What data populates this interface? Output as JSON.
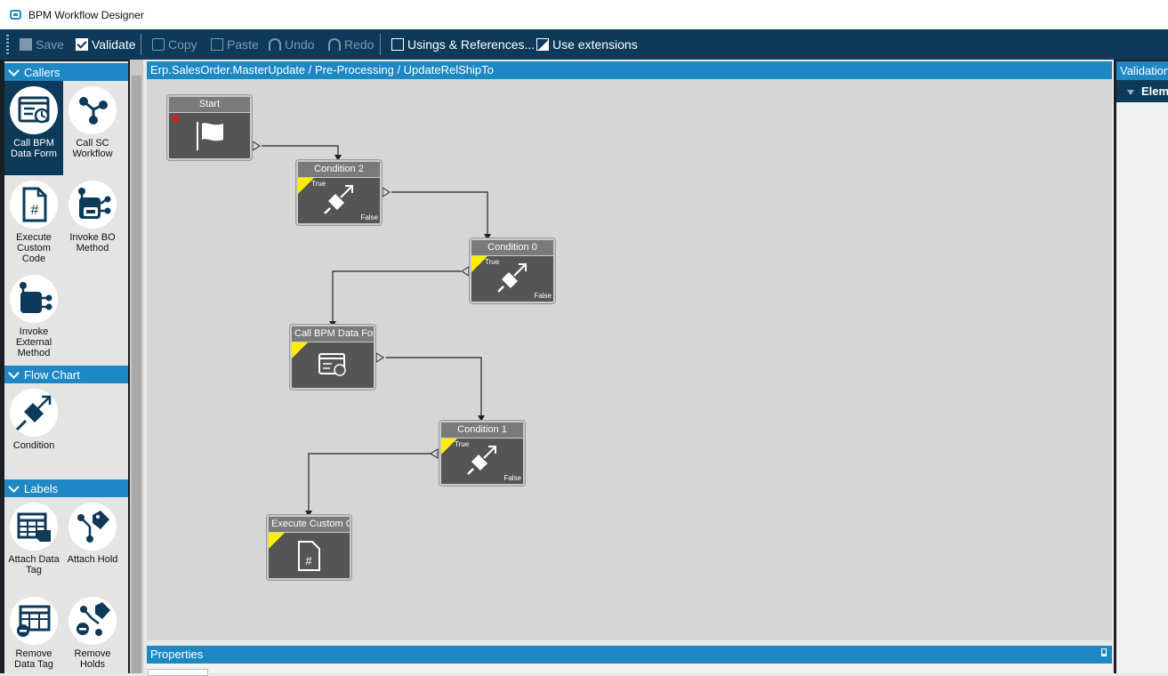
{
  "window": {
    "title": "BPM Workflow Designer"
  },
  "toolbar": {
    "save": "Save",
    "validate": "Validate",
    "copy": "Copy",
    "paste": "Paste",
    "undo": "Undo",
    "redo": "Redo",
    "usings": "Usings & References...",
    "extensions": "Use extensions"
  },
  "toolbox": {
    "callers": {
      "title": "Callers",
      "items": [
        "Call BPM Data Form",
        "Call SC Workflow",
        "Execute Custom Code",
        "Invoke BO Method",
        "Invoke External Method"
      ]
    },
    "flowchart": {
      "title": "Flow Chart",
      "items": [
        "Condition"
      ]
    },
    "labels": {
      "title": "Labels",
      "items": [
        "Attach Data Tag",
        "Attach Hold",
        "Remove Data Tag",
        "Remove Holds"
      ]
    }
  },
  "designer": {
    "breadcrumb": "Erp.SalesOrder.MasterUpdate / Pre-Processing / UpdateRelShipTo",
    "nodes": {
      "start": {
        "title": "Start"
      },
      "condition2": {
        "title": "Condition 2",
        "true": "True",
        "false": "False"
      },
      "condition0": {
        "title": "Condition 0",
        "true": "True",
        "false": "False"
      },
      "callbpm": {
        "title": "Call BPM Data Form"
      },
      "condition1": {
        "title": "Condition 1",
        "true": "True",
        "false": "False"
      },
      "execcode": {
        "title": "Execute Custom Code"
      }
    }
  },
  "properties": {
    "title": "Properties"
  },
  "validation": {
    "title": "Validation",
    "column": "Element"
  },
  "colors": {
    "accent": "#1e88c4",
    "toolbar": "#0d3a59",
    "node": "#555555",
    "flag": "#ffee00"
  }
}
